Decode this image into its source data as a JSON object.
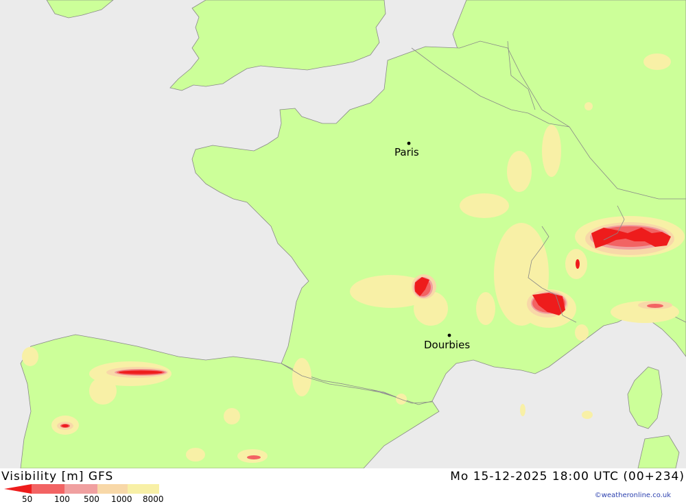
{
  "map": {
    "cities": [
      {
        "name": "Paris"
      },
      {
        "name": "Dourbies"
      }
    ],
    "colors": {
      "sea": "#ebebeb",
      "land": "#ccff99",
      "vis_8000": "#f8f0a6",
      "vis_1000": "#f8d8a8",
      "vis_500": "#f0a0a0",
      "vis_100": "#f26363",
      "vis_50": "#ee1c1c",
      "border": "#888888"
    }
  },
  "footer": {
    "parameter": "Visibility [m] GFS",
    "datetime": "Mo 15-12-2025 18:00 UTC (00+234)",
    "credit": "©weatheronline.co.uk",
    "scale_ticks": [
      "50",
      "100",
      "500",
      "1000",
      "8000"
    ]
  }
}
